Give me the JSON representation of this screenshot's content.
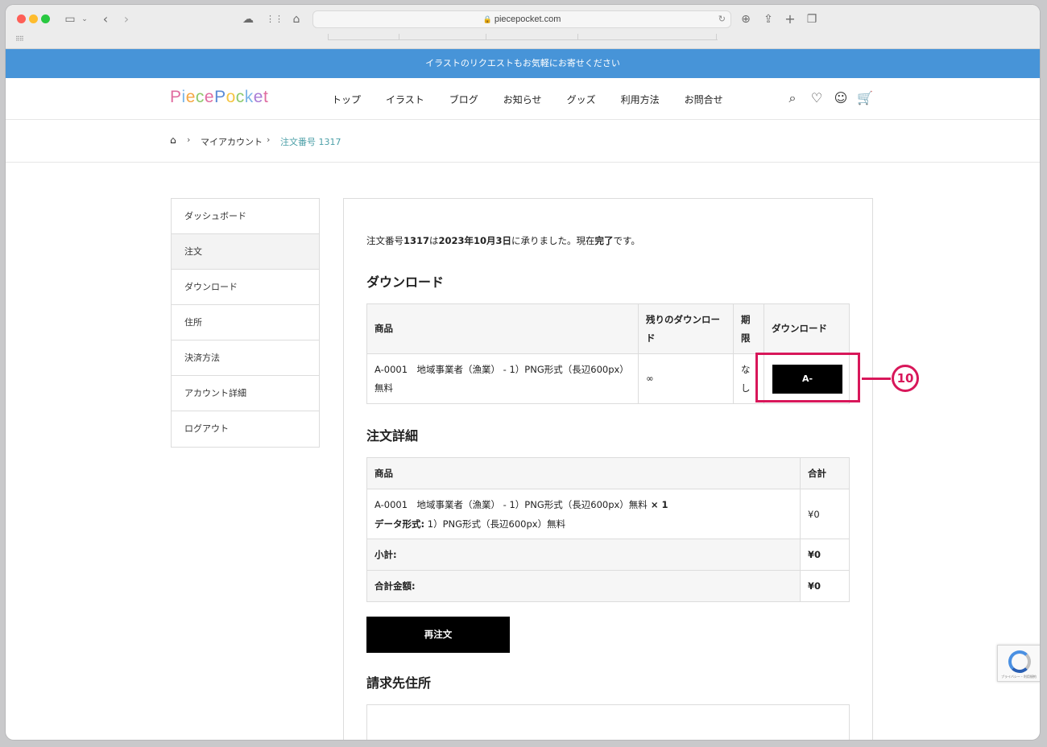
{
  "browser": {
    "url": "piecepocket.com"
  },
  "announcement": "イラストのリクエストもお気軽にお寄せください",
  "header": {
    "logo": "PiecePocket",
    "nav": [
      "トップ",
      "イラスト",
      "ブログ",
      "お知らせ",
      "グッズ",
      "利用方法",
      "お問合せ"
    ]
  },
  "breadcrumb": {
    "home_icon": "home-icon",
    "items": [
      "マイアカウント",
      "注文番号 1317"
    ]
  },
  "sidebar": {
    "items": [
      "ダッシュボード",
      "注文",
      "ダウンロード",
      "住所",
      "決済方法",
      "アカウント詳細",
      "ログアウト"
    ],
    "active": "注文"
  },
  "order": {
    "intro_1": "注文番号",
    "intro_num": "1317",
    "intro_2": "は",
    "intro_date": "2023年10月3日",
    "intro_3": "に承りました。現在",
    "intro_status": "完了",
    "intro_4": "です。"
  },
  "downloads": {
    "heading": "ダウンロード",
    "columns": [
      "商品",
      "残りのダウンロード",
      "期限",
      "ダウンロード"
    ],
    "row": {
      "product_line1": "A-0001　地域事業者（漁業） - 1）PNG形式（長辺600px）",
      "product_line2": "無料",
      "remaining": "∞",
      "expires": "なし",
      "button": "A-"
    }
  },
  "details": {
    "heading": "注文詳細",
    "columns": [
      "商品",
      "合計"
    ],
    "item_line1": "A-0001　地域事業者（漁業） - 1）PNG形式（長辺600px）無料",
    "item_qty": " × 1",
    "item_meta_label": "データ形式:",
    "item_meta_value": " 1）PNG形式（長辺600px）無料",
    "item_total": "¥0",
    "subtotal_label": "小計:",
    "subtotal_value": "¥0",
    "total_label": "合計金額:",
    "total_value": "¥0",
    "reorder_button": "再注文"
  },
  "billing": {
    "heading": "請求先住所"
  },
  "annotation": {
    "number": "⑩"
  },
  "colors": {
    "announce_bg": "#4794d8",
    "callout": "#d8175a",
    "breadcrumb_current": "#4da0a8"
  }
}
